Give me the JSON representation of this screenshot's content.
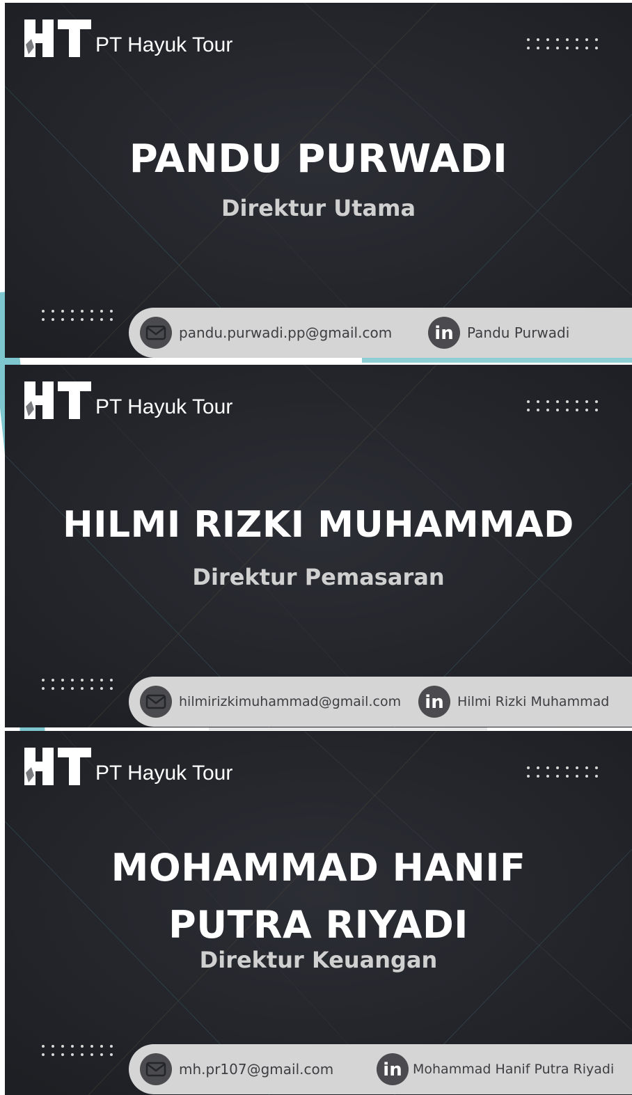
{
  "company": {
    "logo_initials": "HT",
    "name": "PT Hayuk Tour"
  },
  "icons": {
    "email": "envelope-icon",
    "linkedin": "linkedin-icon",
    "linkedin_glyph": "in",
    "dots": "dot-grid-decoration"
  },
  "colors": {
    "card_background": "#23252b",
    "contact_bar": "#d5d5d5",
    "icon_circle": "#4b4b4f",
    "swoosh": "#5fb9c2"
  },
  "cards": [
    {
      "name_lines": [
        "PANDU PURWADI"
      ],
      "title": "Direktur Utama",
      "email": "pandu.purwadi.pp@gmail.com",
      "linkedin": "Pandu Purwadi"
    },
    {
      "name_lines": [
        "HILMI RIZKI MUHAMMAD"
      ],
      "title": "Direktur Pemasaran",
      "email": "hilmirizkimuhammad@gmail.com",
      "linkedin": "Hilmi Rizki Muhammad"
    },
    {
      "name_lines": [
        "MOHAMMAD HANIF",
        "PUTRA RIYADI"
      ],
      "title": "Direktur Keuangan",
      "email": "mh.pr107@gmail.com",
      "linkedin": "Mohammad Hanif Putra Riyadi"
    }
  ]
}
